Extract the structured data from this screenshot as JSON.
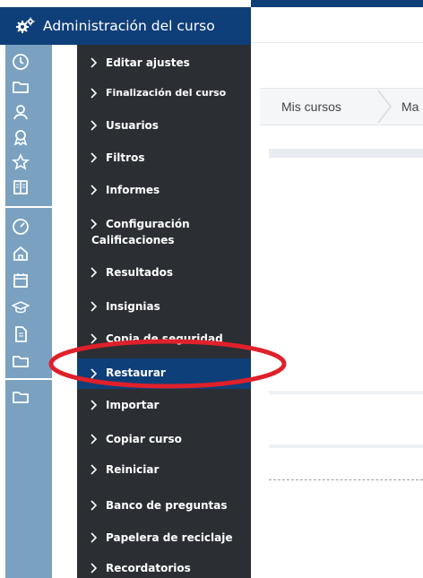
{
  "admin_header": {
    "title": "Administración del curso"
  },
  "breadcrumb": {
    "items": [
      "Mis cursos",
      "Ma"
    ]
  },
  "rail_icons": [
    "clock-icon",
    "folder-icon",
    "users-icon",
    "award-icon",
    "star-icon",
    "book-icon",
    "dashboard-icon",
    "home-icon",
    "calendar-icon",
    "graduation-cap-icon",
    "document-icon",
    "folder-icon",
    "folder-icon"
  ],
  "menu": {
    "items": [
      {
        "label": "Editar ajustes"
      },
      {
        "label": "Finalización del curso"
      },
      {
        "label": "Usuarios"
      },
      {
        "label": "Filtros"
      },
      {
        "label": "Informes"
      },
      {
        "label": "Configuración",
        "label2": "Calificaciones"
      },
      {
        "label": "Resultados"
      },
      {
        "label": "Insignias"
      },
      {
        "label": "Copia de seguridad"
      },
      {
        "label": "Restaurar",
        "active": true
      },
      {
        "label": "Importar"
      },
      {
        "label": "Copiar curso"
      },
      {
        "label": "Reiniciar"
      },
      {
        "label": "Banco de preguntas"
      },
      {
        "label": "Papelera de reciclaje"
      },
      {
        "label": "Recordatorios"
      }
    ]
  },
  "colors": {
    "header": "#0f3f78",
    "menu_bg": "#2b2f34",
    "rail": "#7aa1c0",
    "highlight_ring": "#e0202a"
  }
}
